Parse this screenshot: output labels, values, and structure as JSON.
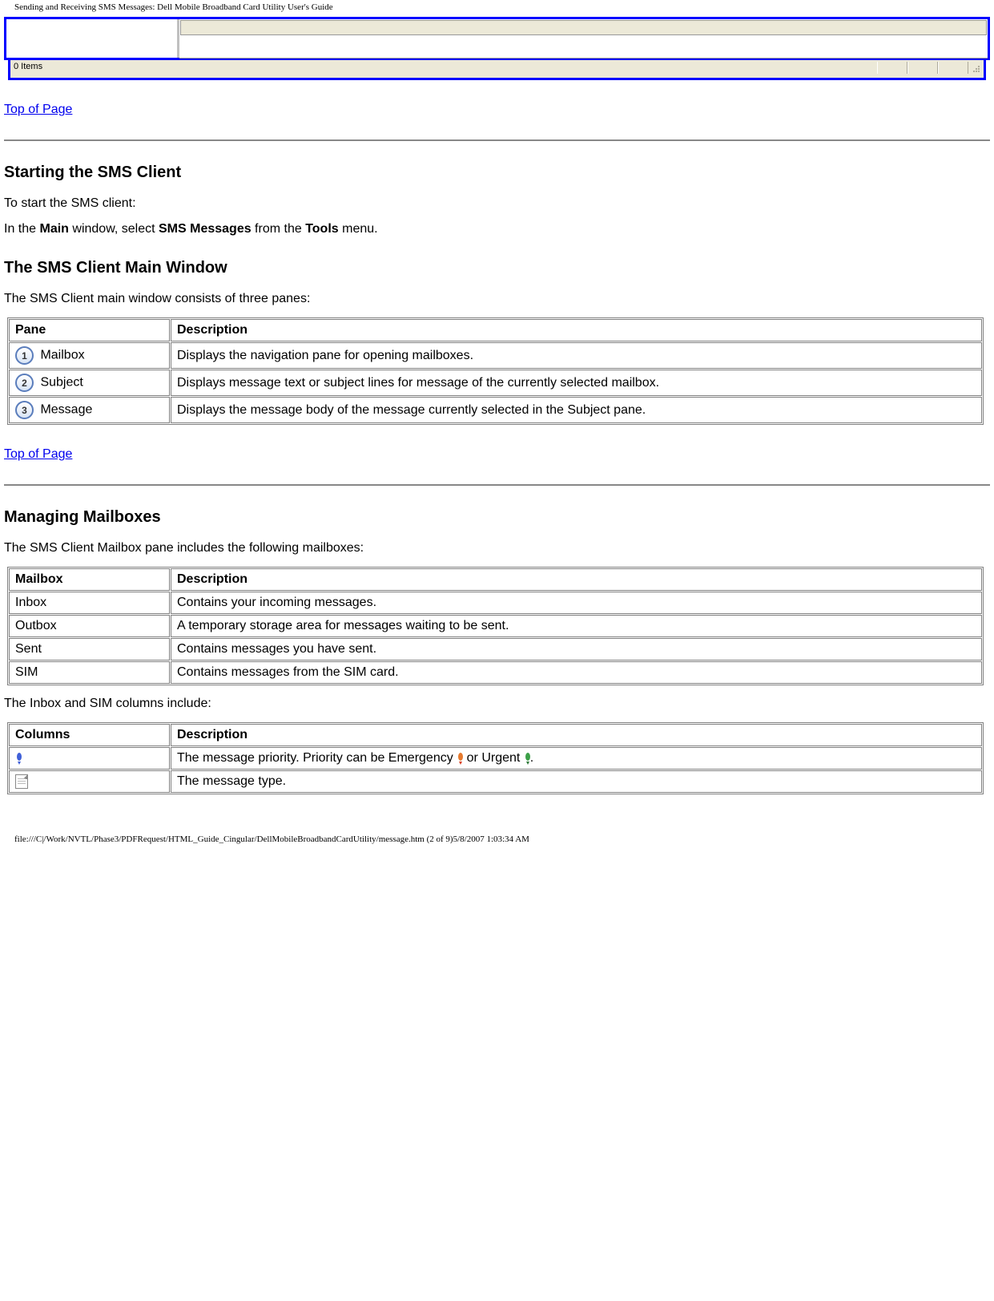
{
  "header": "Sending and Receiving SMS Messages: Dell Mobile Broadband Card Utility User's Guide",
  "statusbar": "0 Items",
  "links": {
    "top_of_page": "Top of Page"
  },
  "section1": {
    "heading": "Starting the SMS Client",
    "p1": "To start the SMS client:",
    "p2_prefix": "In the ",
    "p2_b1": "Main",
    "p2_mid1": " window, select ",
    "p2_b2": "SMS Messages",
    "p2_mid2": " from the ",
    "p2_b3": "Tools",
    "p2_suffix": " menu."
  },
  "section2": {
    "heading": "The SMS Client Main Window",
    "p1": "The SMS Client main window consists of three panes:",
    "table": {
      "h1": "Pane",
      "h2": "Description",
      "rows": [
        {
          "num": "1",
          "name": "Mailbox",
          "desc": "Displays the navigation pane for opening mailboxes."
        },
        {
          "num": "2",
          "name": "Subject",
          "desc": "Displays message text or subject lines for message of the currently selected mailbox."
        },
        {
          "num": "3",
          "name": "Message",
          "desc": "Displays the message body of the message currently selected in the Subject pane."
        }
      ]
    }
  },
  "section3": {
    "heading": "Managing Mailboxes",
    "p1": "The SMS Client Mailbox pane includes the following mailboxes:",
    "table1": {
      "h1": "Mailbox",
      "h2": "Description",
      "rows": [
        {
          "name": "Inbox",
          "desc": "Contains your incoming messages."
        },
        {
          "name": "Outbox",
          "desc": "A temporary storage area for messages waiting to be sent."
        },
        {
          "name": "Sent",
          "desc": "Contains messages you have sent."
        },
        {
          "name": "SIM",
          "desc": "Contains messages from the SIM card."
        }
      ]
    },
    "p2": "The Inbox and SIM columns include:",
    "table2": {
      "h1": "Columns",
      "h2": "Description",
      "row1_desc_pre": "The message priority. Priority can be Emergency",
      "row1_desc_mid": " or Urgent",
      "row1_desc_end": ".",
      "row2_desc": "The message type."
    }
  },
  "footer": "file:///C|/Work/NVTL/Phase3/PDFRequest/HTML_Guide_Cingular/DellMobileBroadbandCardUtility/message.htm (2 of 9)5/8/2007 1:03:34 AM"
}
